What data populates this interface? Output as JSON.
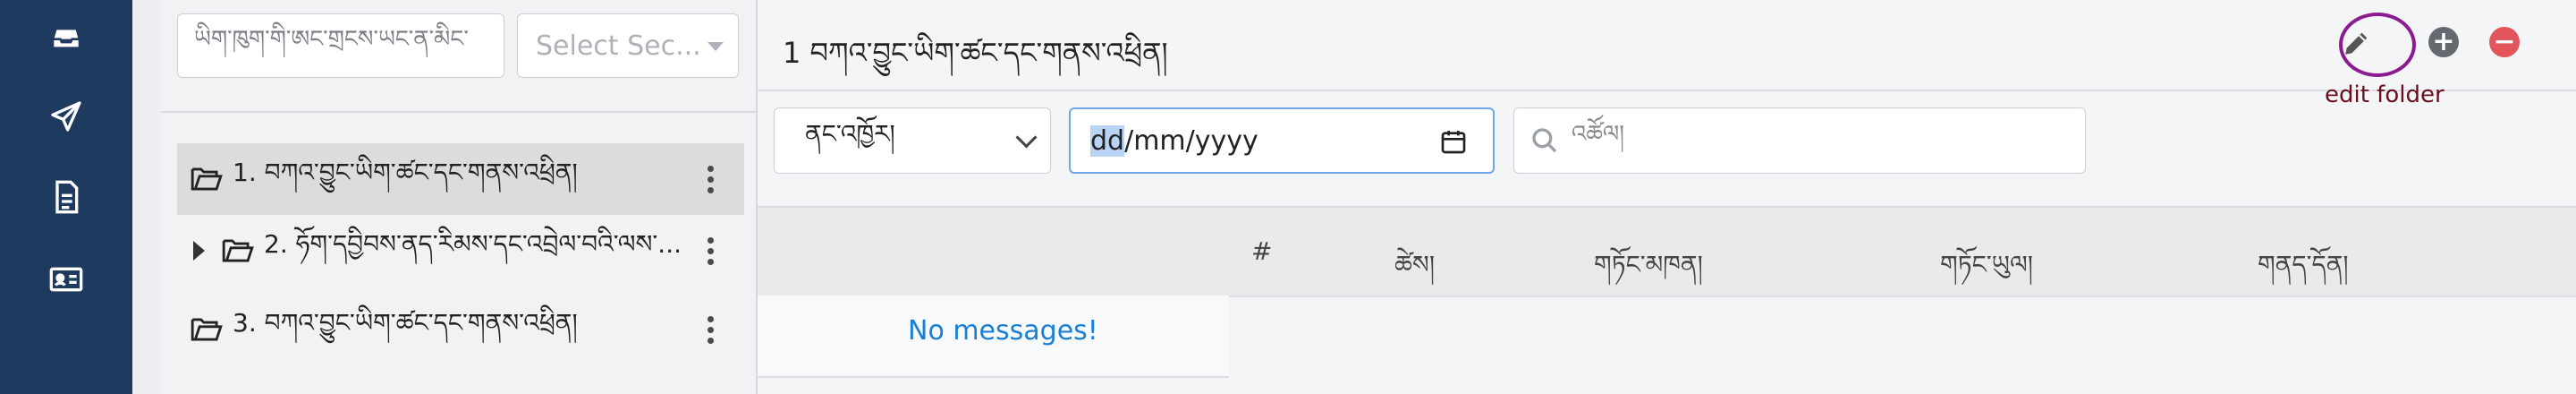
{
  "colors": {
    "rail": "#1f3a5f",
    "accent_ring": "#8a1c8f",
    "caption": "#6a0f1e",
    "add": "#646970",
    "remove": "#e2555c",
    "link": "#1a7fd6"
  },
  "rail": {
    "icons": [
      "inbox-icon",
      "send-icon",
      "document-icon",
      "contact-card-icon"
    ]
  },
  "folder_panel": {
    "search_placeholder": "ཡིག་ཁུག་གི་ཨང་གྲངས་ཡང་ན་མིང་",
    "section_select": "Select Sec...",
    "folders": [
      {
        "label": "1. བཀའ་བྱུང་ཡིག་ཚང་དང་གནས་འཕྲིན།",
        "selected": true,
        "expandable": false
      },
      {
        "label": "2. ཧོག་དབྱིབས་ནད་རིམས་དང་འབྲེལ་བའི་ལས་...",
        "selected": false,
        "expandable": true
      },
      {
        "label": "3. བཀའ་བྱུང་ཡིག་ཚང་དང་གནས་འཕྲིན།",
        "selected": false,
        "expandable": false
      }
    ]
  },
  "main": {
    "title": "1 བཀའ་བྱུང་ཡིག་ཚང་དང་གནས་འཕྲིན།",
    "edit_caption": "edit folder",
    "filter_select": "ནང་འཁྱོར།",
    "date": {
      "highlight": "dd",
      "rest": "/mm/yyyy"
    },
    "search_placeholder": "འཚོལ།",
    "columns": [
      "#",
      "ཚེས།",
      "གཏོང་མཁན།",
      "གཏོང་ཡུལ།",
      "གནད་དོན།"
    ],
    "empty_message": "No messages!"
  }
}
